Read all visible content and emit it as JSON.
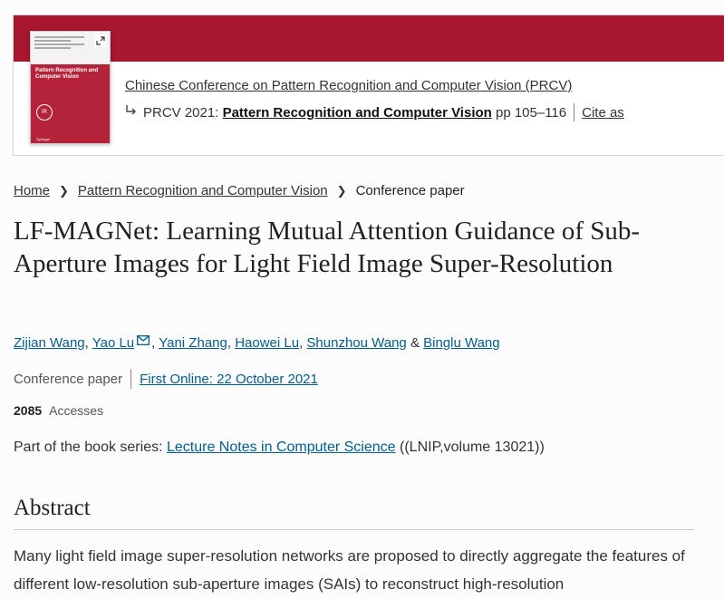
{
  "book": {
    "conference_link": "Chinese Conference on Pattern Recognition and Computer Vision (PRCV)",
    "conference_short": "PRCV 2021:",
    "book_title": "Pattern Recognition and Computer Vision",
    "pages": "pp 105–116",
    "cite_as": "Cite as",
    "cover": {
      "title": "Pattern Recognition and Computer Vision",
      "springer": "Springer"
    }
  },
  "breadcrumb": {
    "home": "Home",
    "book": "Pattern Recognition and Computer Vision",
    "current": "Conference paper"
  },
  "paper": {
    "title": "LF-MAGNet: Learning Mutual Attention Guidance of Sub-Aperture Images for Light Field Image Super-Resolution",
    "authors": [
      "Zijian Wang",
      "Yao Lu",
      "Yani Zhang",
      "Haowei Lu",
      "Shunzhou Wang",
      "Binglu Wang"
    ],
    "type": "Conference paper",
    "first_online": "First Online: 22 October 2021",
    "accesses_count": "2085",
    "accesses_label": "Accesses",
    "series_prefix": "Part of the book series: ",
    "series_name": "Lecture Notes in Computer Science",
    "series_suffix": " ((LNIP,volume 13021))"
  },
  "abstract": {
    "heading": "Abstract",
    "text": "Many light field image super-resolution networks are proposed to directly aggregate the features of different low-resolution sub-aperture images (SAIs) to reconstruct high-resolution"
  },
  "colors": {
    "banner": "#a8162f",
    "link": "#025e8d"
  }
}
